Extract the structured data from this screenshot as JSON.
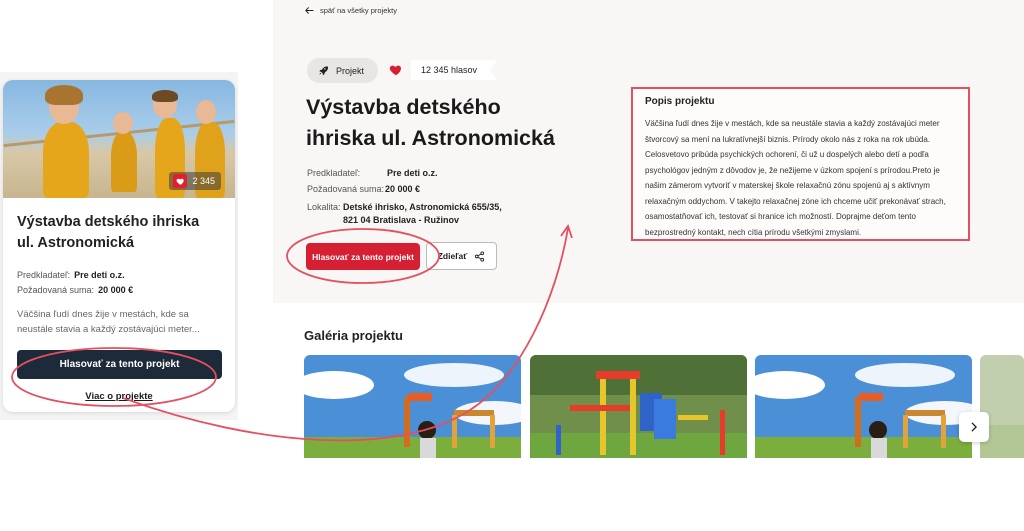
{
  "card": {
    "votes": "2 345",
    "title": "Výstavba detského ihriska ul. Astronomická",
    "submitter_label": "Predkladateľ:",
    "submitter_value": "Pre deti o.z.",
    "amount_label": "Požadovaná suma:",
    "amount_value": "20 000 €",
    "description": "Väčšina ľudí dnes žije v mestách, kde sa neustále stavia a každý zostávajúci meter...",
    "vote_button": "Hlasovať za tento projekt",
    "more_link": "Viac o projekte"
  },
  "detail": {
    "back_link": "späť na všetky projekty",
    "tag_label": "Projekt",
    "votes": "12 345 hlasov",
    "title": "Výstavba detského ihriska ul. Astronomická",
    "submitter_label": "Predkladateľ:",
    "submitter_value": "Pre deti o.z.",
    "amount_label": "Požadovaná suma:",
    "amount_value": "20 000 €",
    "location_label": "Lokalita:",
    "location_line1": "Detské ihrisko, Astronomická 655/35,",
    "location_line2": "821 04 Bratislava - Ružinov",
    "vote_button": "Hlasovať za tento projekt",
    "share_button": "Zdieľať",
    "description_title": "Popis projektu",
    "description_text": "Väčšina ľudí dnes žije v mestách, kde sa neustále stavia a každý zostávajúci meter štvorcový sa mení na lukratívnejší biznis. Prírody okolo nás z roka na rok ubúda. Celosvetovo pribúda psychických ochorení, či už u dospelých alebo detí a podľa psychológov jedným z dôvodov je, že nežijeme v úzkom spojení s prírodou.Preto je našim zámerom vytvoriť v materskej škole relaxačnú zónu spojenú aj s aktívnym relaxačným oddychom. V takejto relaxačnej zóne ich chceme učiť prekonávať strach, osamostatňovať ich, testovať si hranice ich možností. Doprajme deťom tento bezprostredný kontakt, nech cítia prírodu všetkými zmyslami.",
    "gallery_title": "Galéria projektu"
  },
  "colors": {
    "primary_red": "#d51f32",
    "navy": "#1c2a3a",
    "annotation_red": "#e45060"
  },
  "icons": [
    "arrow-left-icon",
    "rocket-icon",
    "heart-icon",
    "share-icon",
    "chevron-right-icon"
  ]
}
